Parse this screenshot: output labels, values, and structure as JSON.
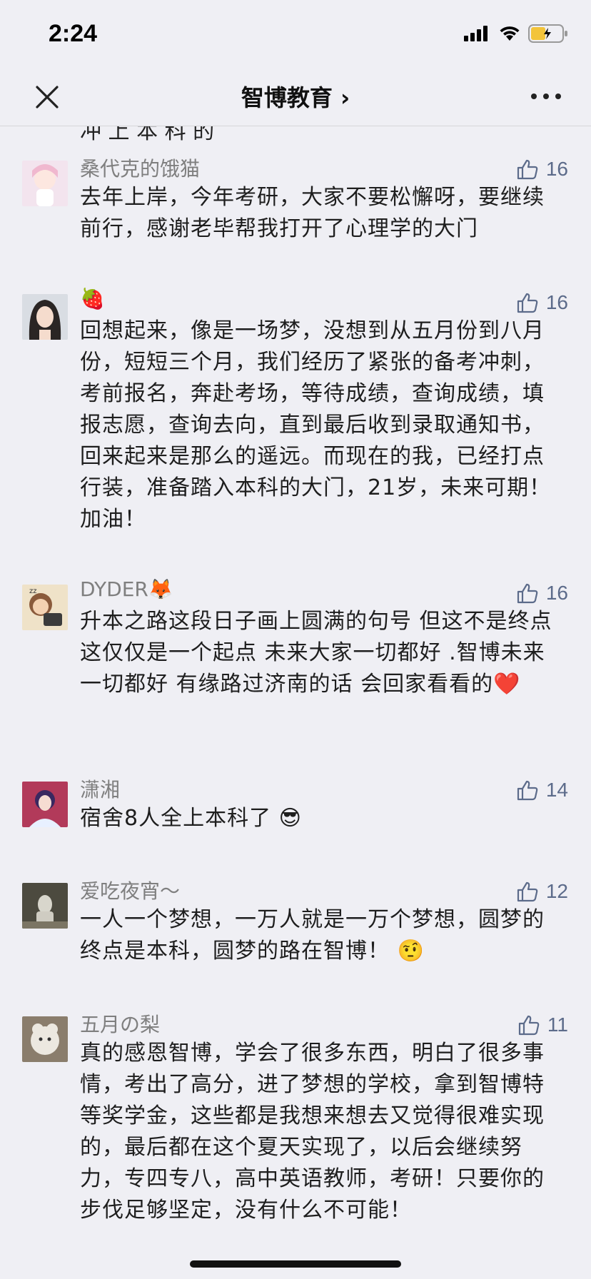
{
  "status": {
    "time": "2:24"
  },
  "nav": {
    "title": "智博教育 ›"
  },
  "cut_text": "冲  上  本  科  的",
  "comments": [
    {
      "name": "桑代克的饿猫",
      "likes": "16",
      "text": "去年上岸，今年考研，大家不要松懈呀，要继续前行，感谢老毕帮我打开了心理学的大门"
    },
    {
      "name": "🍓",
      "likes": "16",
      "text": "回想起来，像是一场梦，没想到从五月份到八月份，短短三个月，我们经历了紧张的备考冲刺，考前报名，奔赴考场，等待成绩，查询成绩，填报志愿，查询去向，直到最后收到录取通知书，回来起来是那么的遥远。而现在的我，已经打点行装，准备踏入本科的大门，21岁，未来可期！加油！"
    },
    {
      "name": "DYDER🦊",
      "likes": "16",
      "text": "升本之路这段日子画上圆满的句号 但这不是终点 这仅仅是一个起点 未来大家一切都好 .智博未来一切都好 有缘路过济南的话 会回家看看的❤️"
    },
    {
      "name": "潇湘",
      "likes": "14",
      "text": "宿舍8人全上本科了 😎"
    },
    {
      "name": "爱吃夜宵～",
      "likes": "12",
      "text": "一人一个梦想，一万人就是一万个梦想，圆梦的终点是本科，圆梦的路在智博！ 🤨"
    },
    {
      "name": "五月の梨",
      "likes": "11",
      "text": "真的感恩智博，学会了很多东西，明白了很多事情，考出了高分，进了梦想的学校，拿到智博特等奖学金，这些都是我想来想去又觉得很难实现的，最后都在这个夏天实现了，以后会继续努力，专四专八，高中英语教师，考研！只要你的步伐足够坚定，没有什么不可能！"
    }
  ]
}
